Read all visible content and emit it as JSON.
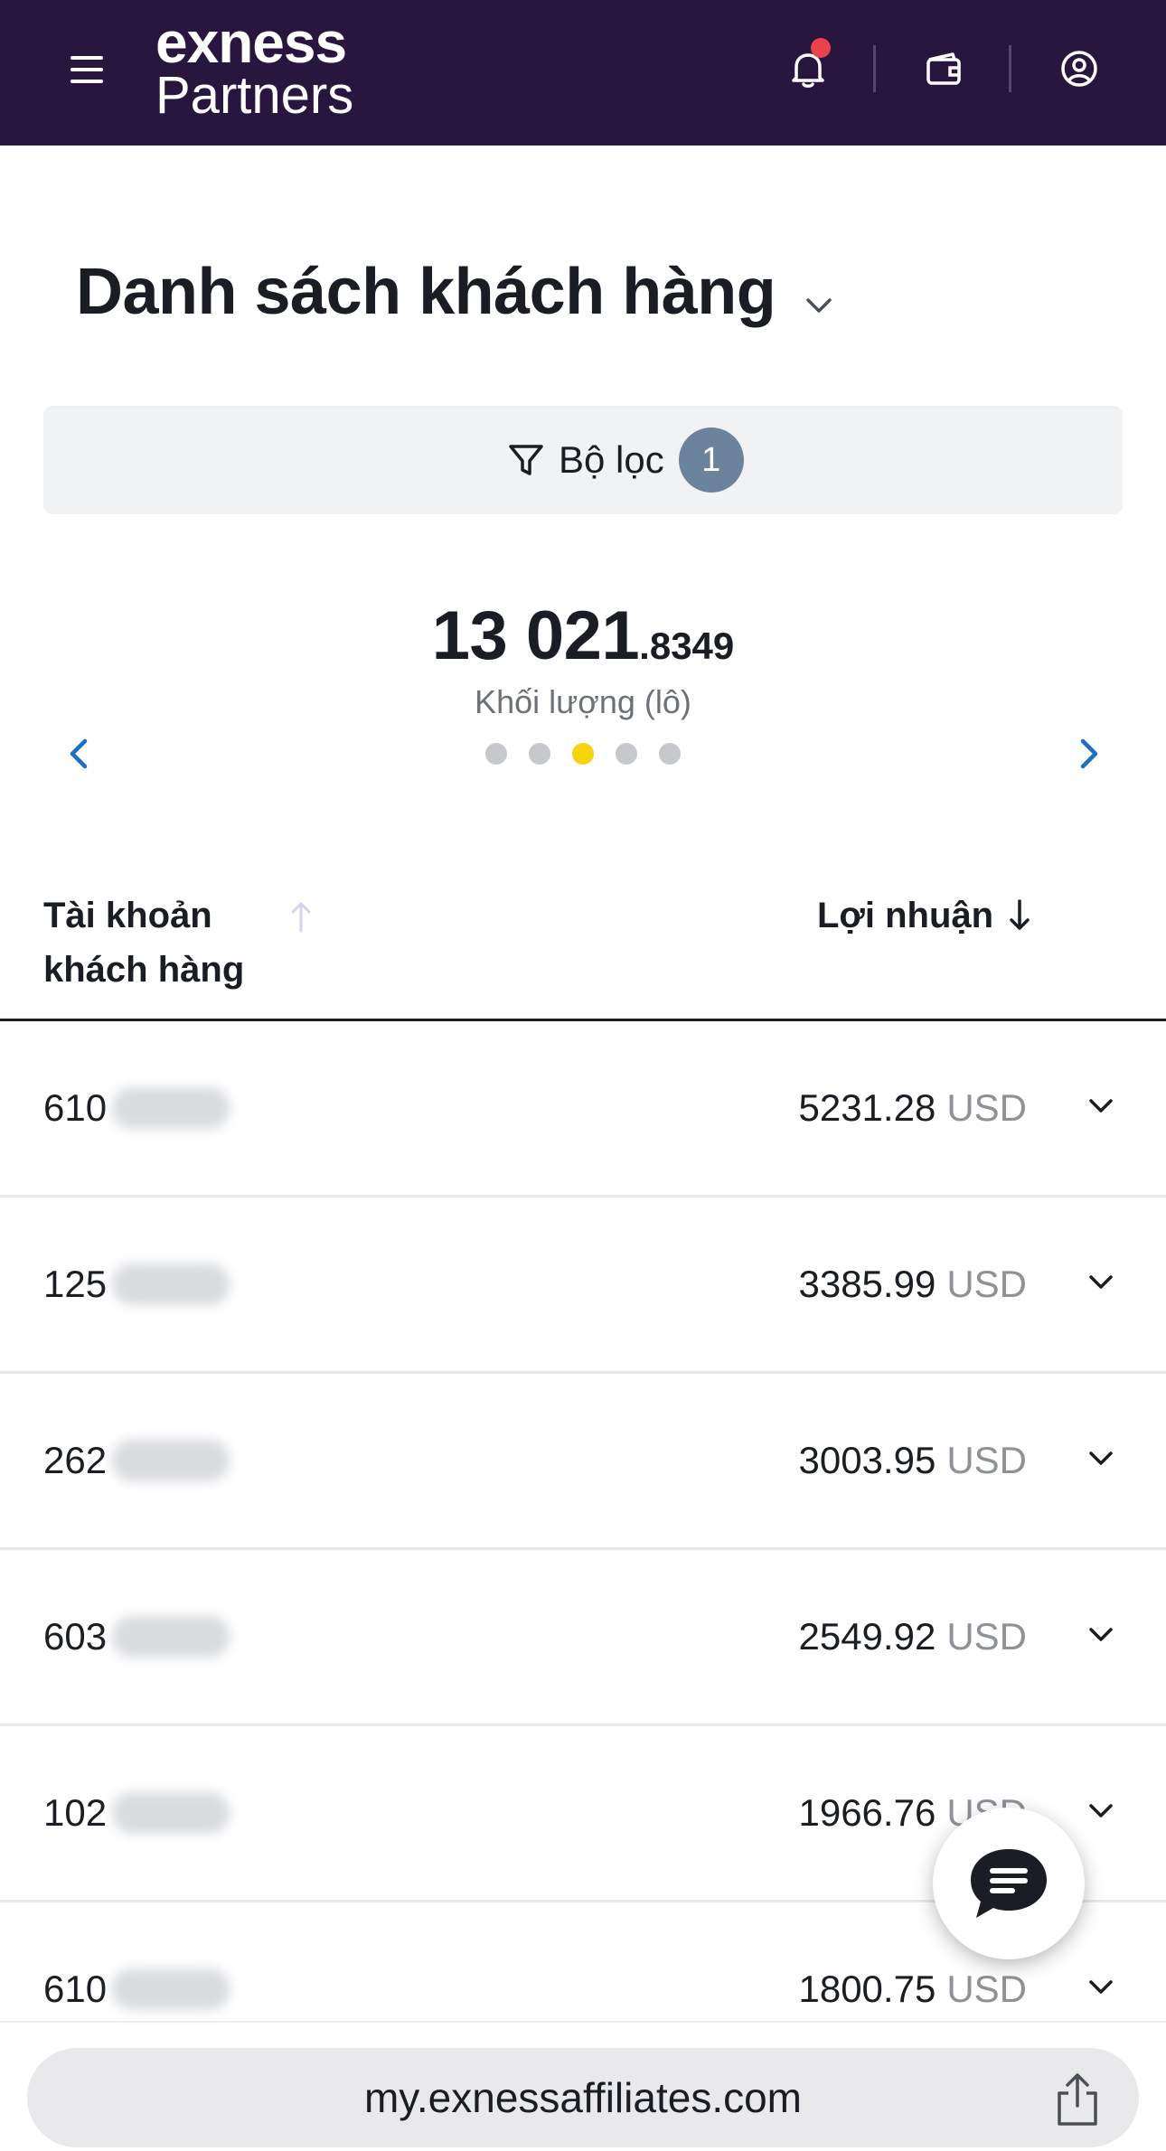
{
  "header": {
    "logo_line1": "exness",
    "logo_line2": "Partners",
    "icons": [
      "menu-icon",
      "bell-icon",
      "wallet-icon",
      "user-icon"
    ],
    "notification_dot_color": "#e8424a",
    "background_color": "#28163f"
  },
  "page": {
    "title": "Danh sách khách hàng"
  },
  "filter": {
    "label": "Bộ lọc",
    "count": "1"
  },
  "metric": {
    "value_int": "13 021",
    "value_dec": ".8349",
    "label": "Khối lượng (lô)",
    "active_dot": 3,
    "dot_count": 5,
    "active_color": "#f5d40c"
  },
  "table": {
    "col_account": "Tài khoản khách hàng",
    "col_profit": "Lợi nhuận",
    "rows": [
      {
        "account_prefix": "610",
        "profit": "5231.28",
        "currency": "USD"
      },
      {
        "account_prefix": "125",
        "profit": "3385.99",
        "currency": "USD"
      },
      {
        "account_prefix": "262",
        "profit": "3003.95",
        "currency": "USD"
      },
      {
        "account_prefix": "603",
        "profit": "2549.92",
        "currency": "USD"
      },
      {
        "account_prefix": "102",
        "profit": "1966.76",
        "currency": "USD"
      },
      {
        "account_prefix": "610",
        "profit": "1800.75",
        "currency": "USD"
      }
    ]
  },
  "browser": {
    "url": "my.exnessaffiliates.com"
  }
}
